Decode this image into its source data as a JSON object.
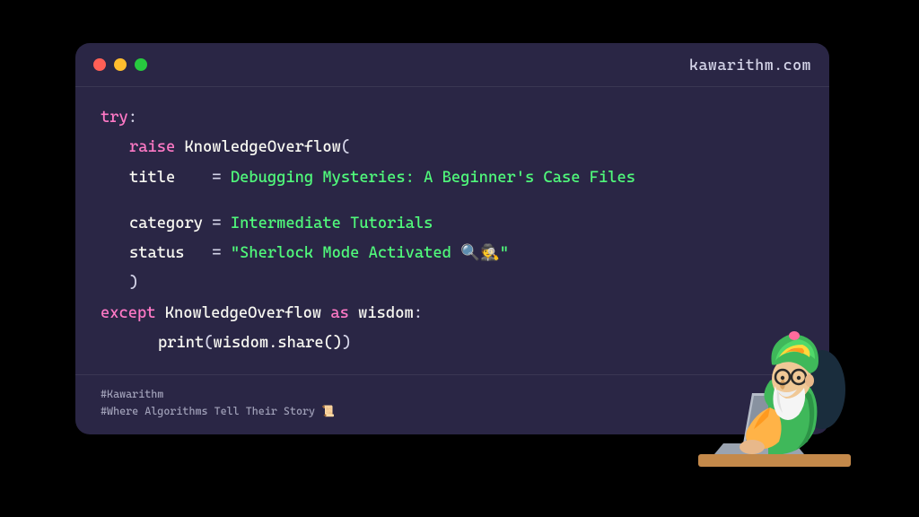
{
  "header": {
    "site": "kawarithm.com"
  },
  "code": {
    "try": "try",
    "colon": ":",
    "raise": "raise",
    "exception_name": "KnowledgeOverflow",
    "open_paren": "(",
    "title_key": "title",
    "eq": "=",
    "title_val": "Debugging Mysteries: A Beginner's Case Files",
    "category_key": "category",
    "category_val": "Intermediate Tutorials",
    "status_key": "status",
    "status_val": "\"Sherlock Mode Activated 🔍🕵️\"",
    "close_paren": ")",
    "except": "except",
    "as": "as",
    "wisdom": "wisdom",
    "print": "print",
    "print_arg_open": "(",
    "print_arg": "wisdom.share()",
    "print_arg_close": ")"
  },
  "footer": {
    "tag1": "#Kawarithm",
    "tag2": "#Where Algorithms Tell Their Story 📜"
  }
}
